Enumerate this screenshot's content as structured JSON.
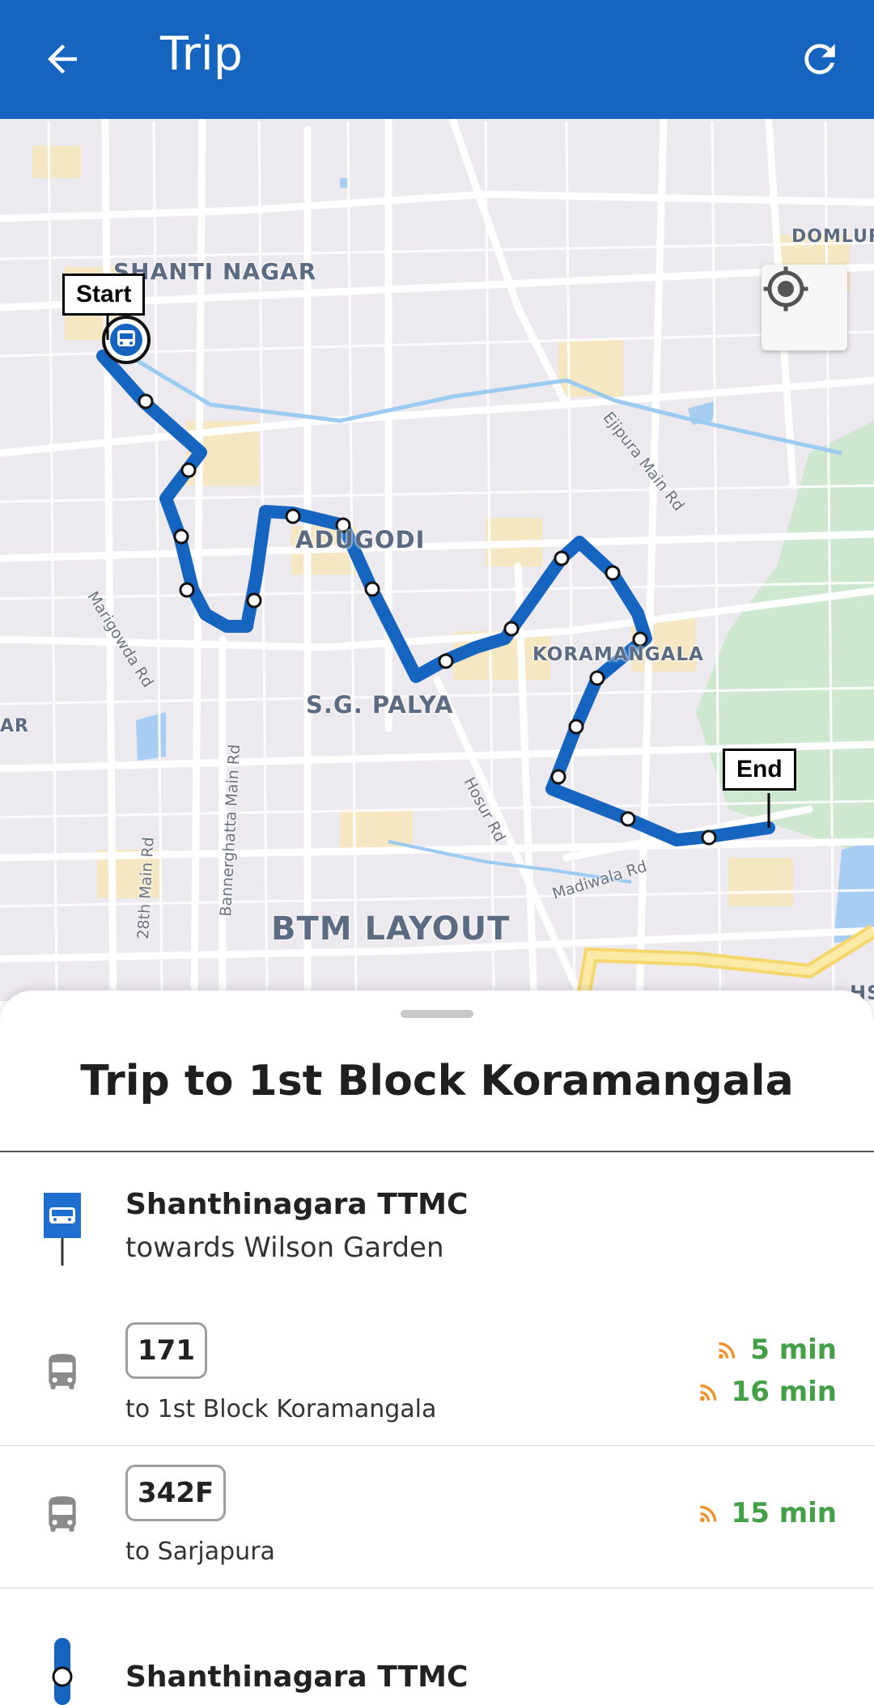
{
  "appbar": {
    "title": "Trip",
    "back_icon": "arrow-back-icon",
    "refresh_icon": "refresh-icon",
    "color": "#1565c0"
  },
  "map": {
    "area_labels": [
      "SHANTI NAGAR",
      "ADUGODI",
      "KORAMANGALA",
      "S.G. PALYA",
      "BTM LAYOUT",
      "DOMLUR",
      "AR",
      "HS"
    ],
    "road_labels": [
      "Marigowda Rd",
      "Ejipura Main Rd",
      "Hosur Rd",
      "Madiwala Rd",
      "Bannerghatta Main Rd",
      "28th Main Rd"
    ],
    "start_tag": "Start",
    "end_tag": "End",
    "route_color": "#1565c0",
    "locate_icon": "my-location-icon"
  },
  "sheet": {
    "title": "Trip to 1st Block Koramangala",
    "origin": {
      "name": "Shanthinagara TTMC",
      "direction": "towards Wilson Garden",
      "icon": "bus-stop-icon"
    },
    "routes": [
      {
        "number": "171",
        "destination": "to 1st Block Koramangala",
        "etas": [
          "5 min",
          "16 min"
        ]
      },
      {
        "number": "342F",
        "destination": "to Sarjapura",
        "etas": [
          "15 min"
        ]
      }
    ],
    "next_stop": {
      "name": "Shanthinagara TTMC"
    },
    "eta_color": "#43a047",
    "live_icon_color": "#f0932b"
  }
}
